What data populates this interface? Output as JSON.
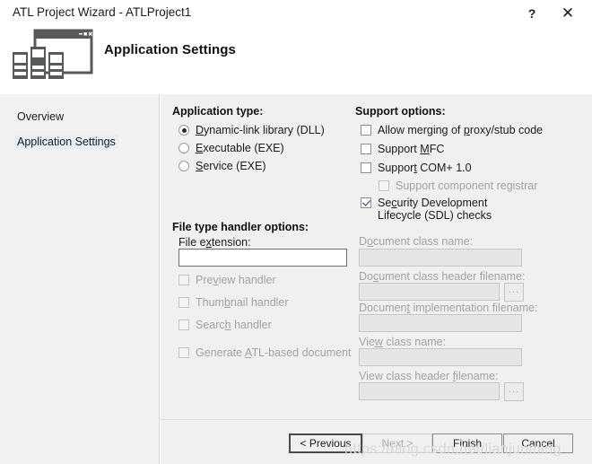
{
  "window": {
    "title": "ATL Project Wizard - ATLProject1",
    "help_label": "?",
    "close_label": "✕"
  },
  "header": {
    "title": "Application Settings",
    "icon": "server-window-icon"
  },
  "sidebar": {
    "items": [
      {
        "label": "Overview",
        "selected": false
      },
      {
        "label": "Application Settings",
        "selected": true
      }
    ]
  },
  "application_type": {
    "title": "Application type:",
    "options": [
      {
        "label": "Dynamic-link library (DLL)",
        "mnemonic": "D",
        "rest": "ynamic-link library (DLL)",
        "checked": true,
        "enabled": true
      },
      {
        "label": "Executable (EXE)",
        "mnemonic": "E",
        "rest": "xecutable (EXE)",
        "checked": false,
        "enabled": true
      },
      {
        "label": "Service (EXE)",
        "mnemonic": "S",
        "rest": "ervice (EXE)",
        "checked": false,
        "enabled": true
      }
    ]
  },
  "support_options": {
    "title": "Support options:",
    "options": [
      {
        "pre": "Allow merging of ",
        "mnemonic": "p",
        "post": "roxy/stub code",
        "checked": false,
        "enabled": true,
        "indent": false
      },
      {
        "pre": "Support ",
        "mnemonic": "M",
        "post": "FC",
        "checked": false,
        "enabled": true,
        "indent": false
      },
      {
        "pre": "Suppor",
        "mnemonic": "t",
        "post": " COM+ 1.0",
        "checked": false,
        "enabled": true,
        "indent": false
      },
      {
        "pre": "Support component registrar",
        "mnemonic": "",
        "post": "",
        "checked": false,
        "enabled": false,
        "indent": true
      },
      {
        "pre": "Se",
        "mnemonic": "c",
        "post": "urity Development Lifecycle (SDL) checks",
        "checked": true,
        "enabled": true,
        "indent": false
      }
    ]
  },
  "file_type_handler": {
    "title": "File type handler options:",
    "extension_label_pre": "File e",
    "extension_label_mnemonic": "x",
    "extension_label_post": "tension:",
    "extension_value": "",
    "options": [
      {
        "pre": "Pre",
        "mnemonic": "v",
        "post": "iew handler",
        "checked": false,
        "enabled": false
      },
      {
        "pre": "Thum",
        "mnemonic": "b",
        "post": "nail handler",
        "checked": false,
        "enabled": false
      },
      {
        "pre": "Searc",
        "mnemonic": "h",
        "post": " handler",
        "checked": false,
        "enabled": false
      },
      {
        "pre": "Generate ",
        "mnemonic": "A",
        "post": "TL-based document",
        "checked": false,
        "enabled": false
      }
    ]
  },
  "document_fields": [
    {
      "pre": "D",
      "mnemonic": "o",
      "post": "cument class name:",
      "value": "",
      "enabled": false,
      "browse": false
    },
    {
      "pre": "Do",
      "mnemonic": "c",
      "post": "ument class header filename:",
      "value": "",
      "enabled": false,
      "browse": true
    },
    {
      "pre": "Documen",
      "mnemonic": "t",
      "post": " implementation filename:",
      "value": "",
      "enabled": false,
      "browse": false
    },
    {
      "pre": "Vie",
      "mnemonic": "w",
      "post": " class name:",
      "value": "",
      "enabled": false,
      "browse": false
    },
    {
      "pre": "View class header ",
      "mnemonic": "f",
      "post": "ilename:",
      "value": "",
      "enabled": false,
      "browse": true
    }
  ],
  "browse_button_label": "...",
  "footer": {
    "buttons": [
      {
        "label": "< Previous",
        "enabled": true,
        "default": true
      },
      {
        "label": "Next >",
        "enabled": false,
        "default": false
      },
      {
        "label": "Finish",
        "enabled": true,
        "default": false
      },
      {
        "label": "Cancel",
        "enabled": true,
        "default": false
      }
    ]
  },
  "watermark": {
    "text": "https://blog.csdn.net/lianjunming"
  },
  "colors": {
    "dialog_bg": "#f0f0f0",
    "sidebar_bg": "#f2f2f2",
    "selection_bg": "#e8eef6",
    "icon": "#58595b",
    "check_mark": "#20356b",
    "disabled_text": "#a3a3a3"
  }
}
